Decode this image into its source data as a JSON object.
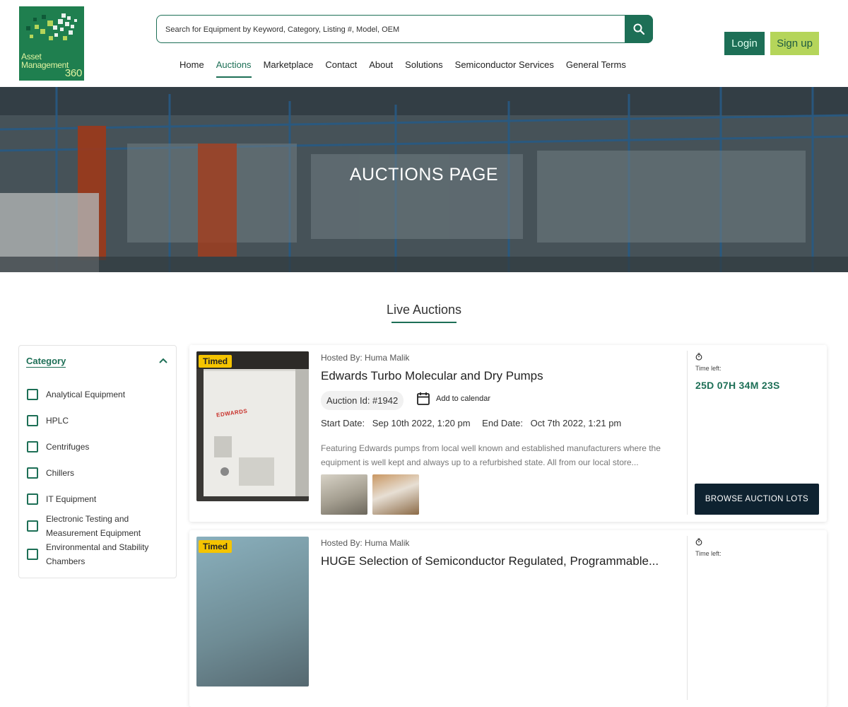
{
  "header": {
    "logo_lines": [
      "Asset",
      "Management",
      "360"
    ],
    "search": {
      "placeholder": "Search for Equipment by Keyword, Category, Listing #, Model, OEM"
    },
    "nav": [
      "Home",
      "Auctions",
      "Marketplace",
      "Contact",
      "About",
      "Solutions",
      "Semiconductor Services",
      "General Terms"
    ],
    "active_nav": "Auctions",
    "login_label": "Login",
    "signup_label": "Sign up",
    "colors": {
      "primary": "#1d6f56",
      "accent": "#b5d55a"
    }
  },
  "hero": {
    "title": "AUCTIONS PAGE"
  },
  "section": {
    "title": "Live Auctions"
  },
  "sidebar": {
    "title": "Category",
    "items": [
      "Analytical Equipment",
      "HPLC",
      "Centrifuges",
      "Chillers",
      "IT Equipment",
      "Electronic Testing and Measurement Equipment",
      "Environmental and Stability Chambers"
    ]
  },
  "auctions": [
    {
      "badge": "Timed",
      "hosted": "Hosted By: Huma Malik",
      "title": "Edwards Turbo Molecular and Dry Pumps",
      "auction_id": "Auction Id: #1942",
      "calendar_label": "Add to calendar",
      "start_label": "Start Date:",
      "start_date": "Sep 10th 2022, 1:20 pm",
      "end_label": "End Date:",
      "end_date": "Oct 7th 2022, 1:21 pm",
      "description": "Featuring Edwards pumps from local well known and established manufacturers where the equipment is well kept and always up to a refurbished state.  All from our local store...",
      "image_brand": "EDWARDS",
      "time_label": "Time left:",
      "time_left": "25D 07H 34M 23S",
      "browse_label": "BROWSE AUCTION LOTS"
    },
    {
      "badge": "Timed",
      "hosted": "Hosted By: Huma Malik",
      "title": "HUGE Selection of Semiconductor Regulated, Programmable...",
      "time_label": "Time left:"
    }
  ]
}
